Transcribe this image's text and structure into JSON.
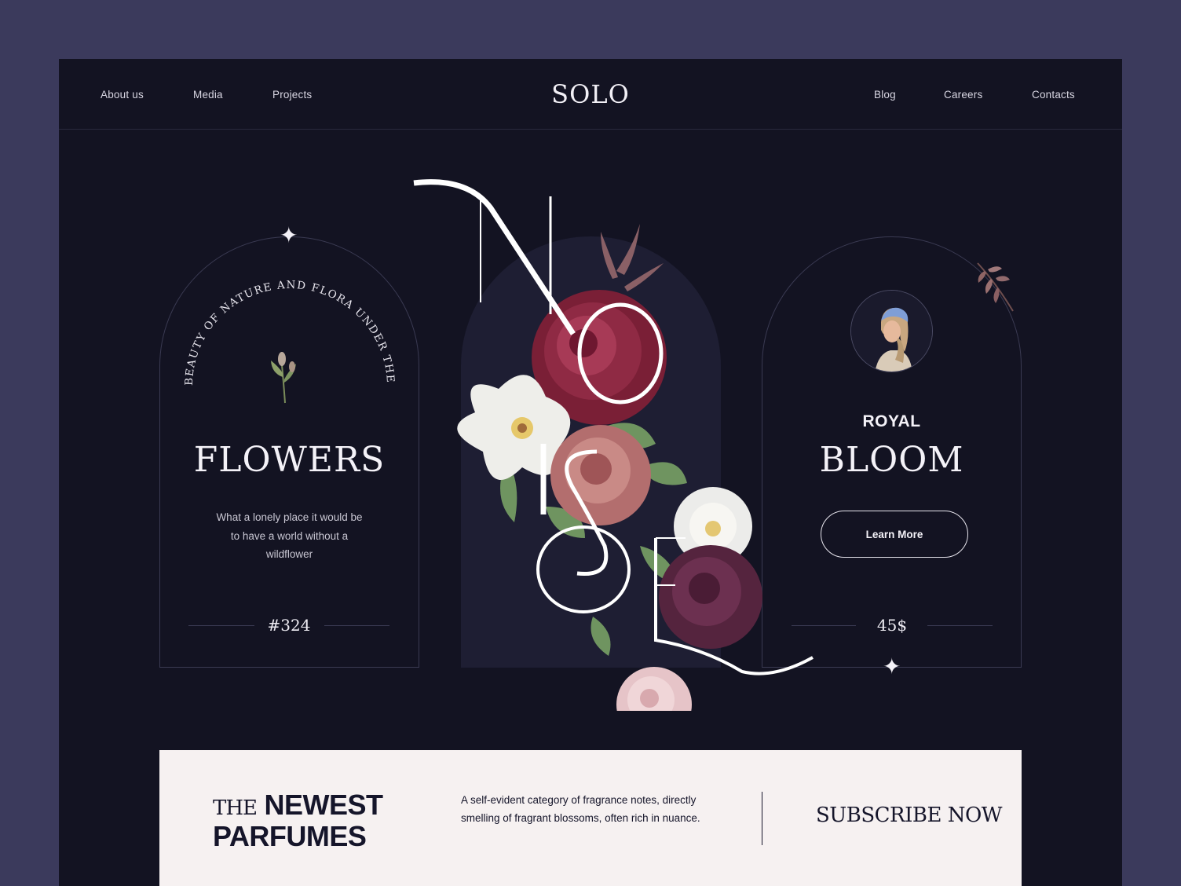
{
  "nav": {
    "left": [
      "About us",
      "Media",
      "Projects"
    ],
    "right": [
      "Blog",
      "Careers",
      "Contacts"
    ],
    "logo": "SOLO"
  },
  "left_card": {
    "curved_text": "BEAUTY OF NATURE AND FLORA UNDER THE STARS",
    "title": "FLOWERS",
    "text_lines": [
      "What a lonely place it would be",
      "to have a world without a",
      "wildflower"
    ],
    "number": "#324"
  },
  "center": {
    "letters": [
      "N",
      "O",
      "I",
      "S",
      "O",
      "E",
      "L"
    ]
  },
  "right_card": {
    "kicker": "ROYAL",
    "title": "BLOOM",
    "button": "Learn More",
    "price": "45$"
  },
  "banner": {
    "title_prefix": "THE",
    "title_line1": "NEWEST",
    "title_line2": "PARFUMES",
    "description": "A self-evident category of fragrance notes, directly smelling of fragrant blossoms, often rich in nuance.",
    "cta": "SUBSCRIBE NOW"
  },
  "colors": {
    "page_bg": "#3b3a5c",
    "frame_bg": "#131322",
    "arch_fill": "#1e1e33",
    "banner_bg": "#f6f1f1",
    "text_light": "#f4f2f8",
    "text_dark": "#15152a"
  },
  "icons": [
    "sparkle-icon",
    "flower-bud-icon",
    "rose-bouquet-illustration",
    "portrait-avatar",
    "leaf-sprig-icon"
  ]
}
